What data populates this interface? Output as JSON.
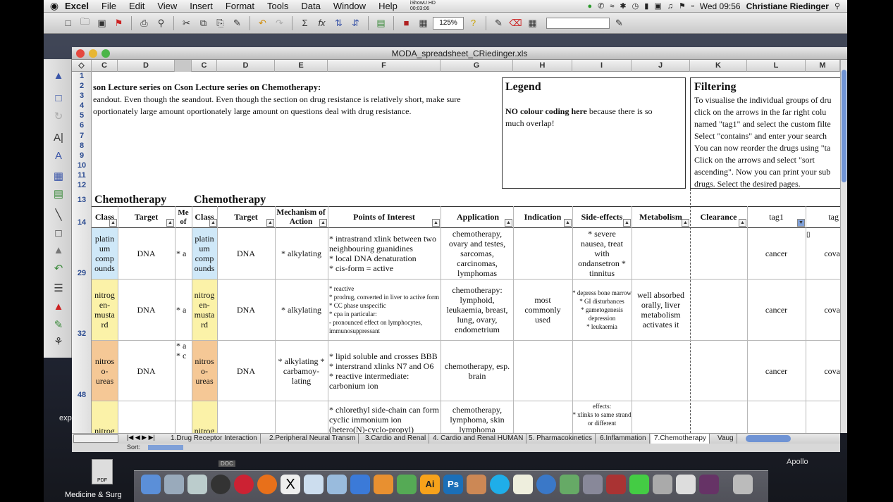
{
  "menubar": {
    "app": "Excel",
    "items": [
      "File",
      "Edit",
      "View",
      "Insert",
      "Format",
      "Tools",
      "Data",
      "Window",
      "Help"
    ],
    "recorder": "iShowU HD",
    "recorder_time": "00:03:06",
    "clock": "Wed 09:56",
    "user": "Christiane Riedinger"
  },
  "toolbar": {
    "zoom": "125%"
  },
  "window": {
    "title": "MODA_spreadsheet_CRiedinger.xls"
  },
  "columns": [
    "C",
    "D",
    "C",
    "D",
    "E",
    "F",
    "G",
    "H",
    "I",
    "J",
    "K",
    "L",
    "M"
  ],
  "rows": [
    "1",
    "2",
    "3",
    "4",
    "5",
    "6",
    "7",
    "8",
    "9",
    "10",
    "11",
    "12",
    "13",
    "14",
    "29",
    "32",
    "48"
  ],
  "intro": {
    "line1": "son Lecture series on Cson Lecture series on Chemotherapy:",
    "line2": "eandout. Even though the seandout. Even though the section on drug resistance is relatively short, make sure",
    "line3": "oportionately large amount oportionately large amount on questions deal with drug resistance."
  },
  "legend": {
    "title": "Legend",
    "bold": "NO colour coding here",
    "text1": " because there is so",
    "text2": "much overlap!"
  },
  "filtering": {
    "title": "Filtering",
    "lines": [
      "To visualise the individual groups of dru",
      "click on the arrows in the far right colu",
      "named \"tag1\" and select the custom filte",
      "Select \"contains\" and enter your search",
      "You can now reorder the drugs using \"ta",
      "Click on the arrows and select \"sort",
      "ascending\". Now you can print your sub",
      "drugs. Select the desired pages."
    ]
  },
  "section_titles": [
    "Chemotherapy",
    "Chemotherapy"
  ],
  "headers": {
    "class": "Class",
    "target": "Target",
    "me": "Me",
    "of": "of",
    "mechanism": "Mechanism of Action",
    "points": "Points of Interest",
    "application": "Application",
    "indication": "Indication",
    "side": "Side-effects",
    "metabolism": "Metabolism",
    "clearance": "Clearance",
    "tag1": "tag1",
    "tag": "tag"
  },
  "drug_rows": [
    {
      "class": "platin um comp ounds",
      "target": "DNA",
      "me": "* a",
      "mechanism": "* alkylating",
      "points": [
        "* intrastrand xlink between two neighbouring guanidines",
        "* local DNA denaturation",
        "* cis-form = active"
      ],
      "application": "chemotherapy, ovary and testes, sarcomas, carcinomas, lymphomas",
      "indication": "",
      "side": "* severe nausea, treat with ondansetron * tinnitus",
      "metabolism": "",
      "tag1": "cancer",
      "tag": "cova"
    },
    {
      "class": "nitrog en- musta rd",
      "target": "DNA",
      "me": "* a",
      "mechanism": "* alkylating",
      "points": [
        "* reactive",
        "* prodrug, converted in liver to active form",
        "* CC phase unspecific",
        "* cpa in particular:",
        "- pronounced effect on lymphocytes, immunosuppressant"
      ],
      "application": "chemotherapy: lymphoid, leukaemia, breast, lung, ovary, endometrium",
      "indication": "most commonly used",
      "side": [
        "* depress bone marrow",
        "* GI disturbances",
        "* gametogenesis depression",
        "* leukaemia"
      ],
      "metabolism": "well absorbed orally, liver metabolism activates it",
      "tag1": "cancer",
      "tag": "cova"
    },
    {
      "class": "nitros o- ureas",
      "target": "DNA",
      "me": "* a",
      "me2": "* c",
      "mechanism": "* alkylating * carbamoy- lating",
      "points": [
        "* lipid soluble and crosses BBB",
        "* interstrand xlinks N7 and O6",
        "* reactive intermediate: carbonium ion"
      ],
      "application": "chemotherapy, esp. brain",
      "indication": "",
      "side": "",
      "metabolism": "",
      "tag1": "cancer",
      "tag": "cova"
    },
    {
      "class": "nitrog",
      "points": [
        "* chlorethyl side-chain can form cyclic immonium ion (hetero(N)-cyclo-propyl)"
      ],
      "application": "chemotherapy, lymphoma, skin lymphoma",
      "side": [
        "effects:",
        "* xlinks to same strand or different"
      ]
    }
  ],
  "tabs": [
    "1.Drug Receptor Interaction",
    "2.Peripheral Neural Transm",
    "3.Cardio and Renal",
    "4. Cardio and Renal HUMAN",
    "5. Pharmacokinetics",
    "6.Inflammation",
    "7.Chemotherapy",
    "Vaug"
  ],
  "sortbar_label": "Sort:",
  "desktop": {
    "label_left": "exp",
    "label_bottom": "Medicine & Surg",
    "label_right": "Apollo",
    "label_doc": "DOC",
    "label_pdf": "PDF",
    "label_ai": "Ai",
    "label_ps": "Ps"
  }
}
